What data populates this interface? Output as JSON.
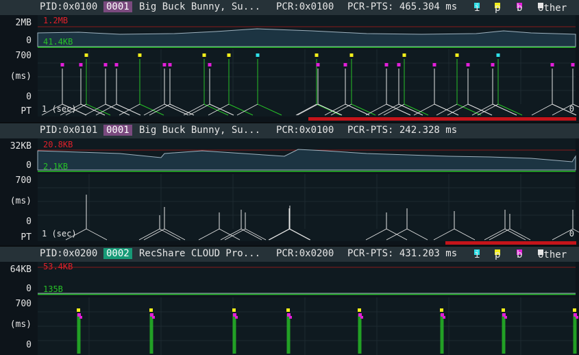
{
  "colors": {
    "header_bg": "#263238",
    "red": "#e0202a",
    "green": "#27c227",
    "i_frame": "#2ee0e8",
    "p_frame": "#f2ee1a",
    "b_frame": "#e21ed9",
    "other": "#e6e6e6"
  },
  "legend": {
    "i": "i",
    "p": "p",
    "b": "b",
    "other": "other"
  },
  "panels": [
    {
      "pid": "PID:0x0100",
      "badge": "0001",
      "badge_color": "#7b4a7f",
      "name": "Big Buck Bunny, Su...",
      "pcr": "PCR:0x0100",
      "pcr_pts": "PCR-PTS: 465.304 ms",
      "show_legend": true,
      "rate_max": "2MB",
      "rate_min": "0",
      "rate_peak": "1.2MB",
      "rate_low": "41.4KB",
      "rate_level": 0.45,
      "ms_max": "700",
      "ms_unit": "(ms)",
      "ms_min": "0",
      "pt_label": "PT",
      "pt_left": "1 (sec)",
      "pt_right": "0",
      "buffer_fill": 0.47
    },
    {
      "pid": "PID:0x0101",
      "badge": "0001",
      "badge_color": "#7b4a7f",
      "name": "Big Buck Bunny, Su...",
      "pcr": "PCR:0x0100",
      "pcr_pts": "PCR-PTS: 242.328 ms",
      "show_legend": false,
      "rate_max": "32KB",
      "rate_min": "0",
      "rate_peak": "20.8KB",
      "rate_low": "2.1KB",
      "rate_level": 0.35,
      "ms_max": "700",
      "ms_unit": "(ms)",
      "ms_min": "0",
      "pt_label": "PT",
      "pt_left": "1 (sec)",
      "pt_right": "0",
      "buffer_fill": 0.23
    },
    {
      "pid": "PID:0x0200",
      "badge": "0002",
      "badge_color": "#179a77",
      "name": "RecShare CLOUD Pro...",
      "pcr": "PCR:0x0200",
      "pcr_pts": "PCR-PTS: 431.203 ms",
      "show_legend": true,
      "rate_max": "64KB",
      "rate_min": "0",
      "rate_peak": "53.4KB",
      "rate_low": "135B",
      "rate_level": 0.02,
      "ms_max": "700",
      "ms_unit": "(ms)",
      "ms_min": "0",
      "pt_label": "",
      "pt_left": "",
      "pt_right": "",
      "buffer_fill": 0
    }
  ]
}
